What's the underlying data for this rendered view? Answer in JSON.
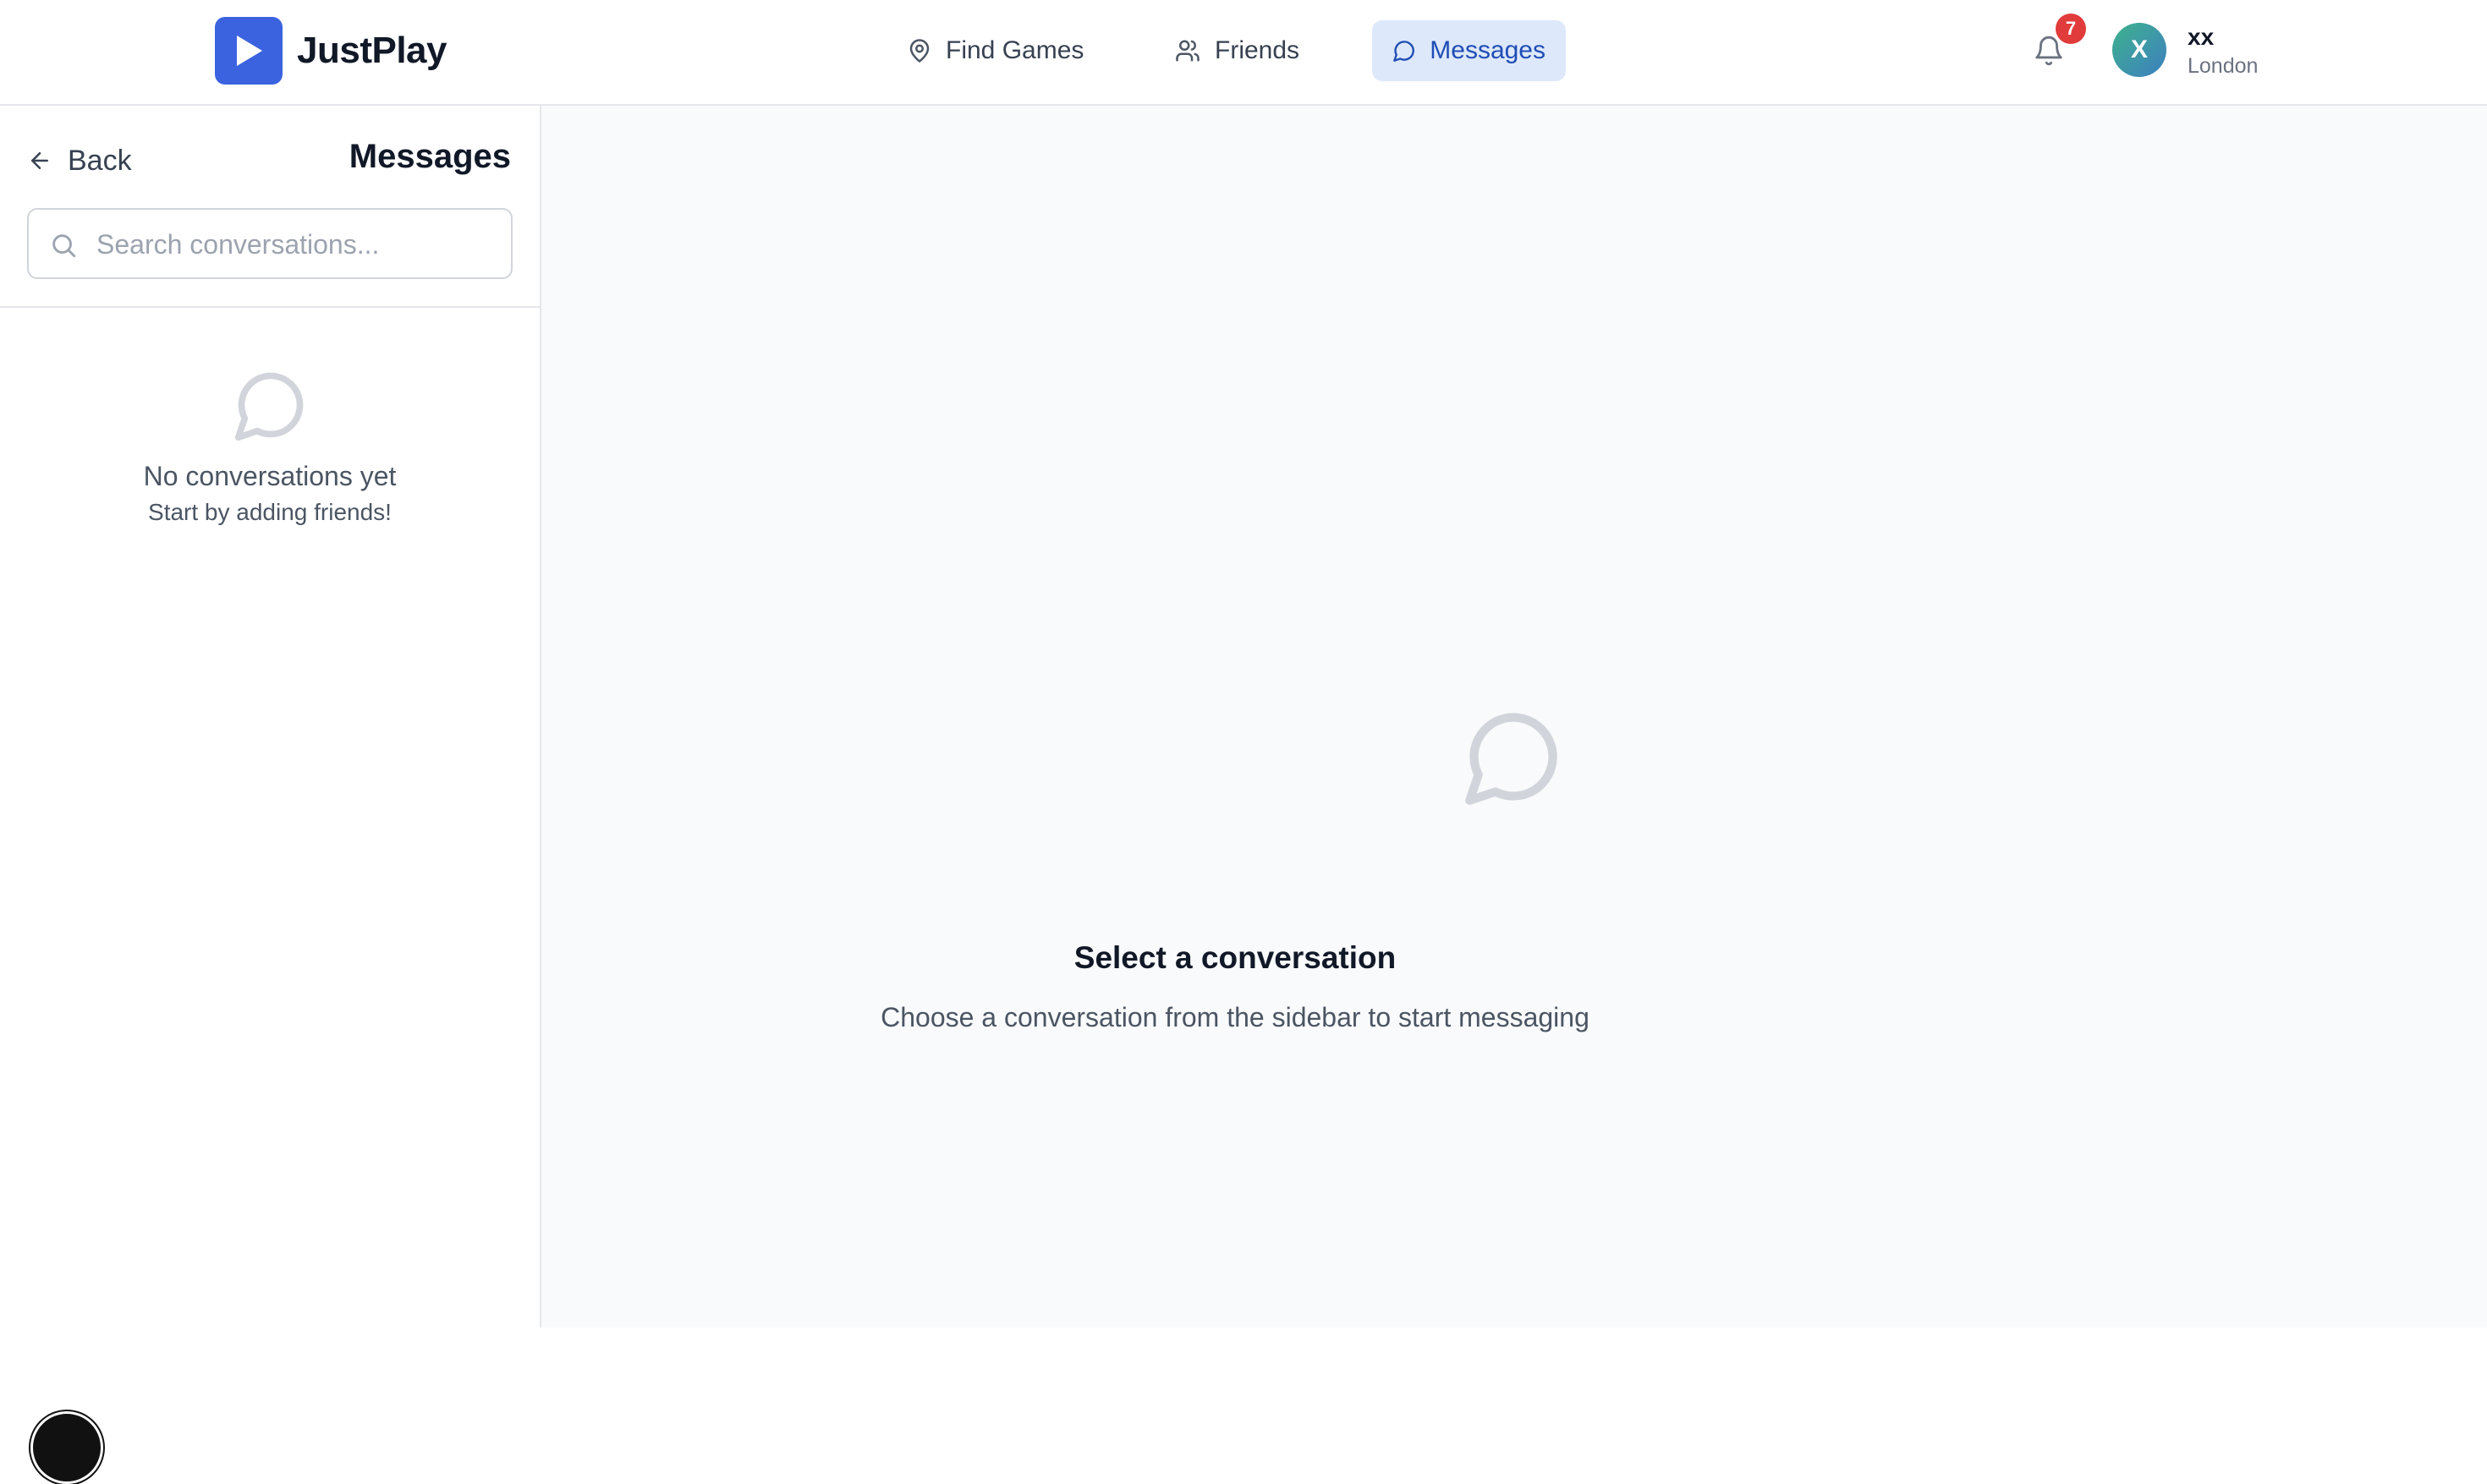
{
  "header": {
    "brand": "JustPlay",
    "nav": [
      {
        "label": "Find Games",
        "icon": "map-pin-icon"
      },
      {
        "label": "Friends",
        "icon": "users-icon"
      },
      {
        "label": "Messages",
        "icon": "message-circle-icon",
        "active": true
      }
    ],
    "notifications": {
      "icon": "bell-icon",
      "count": "7"
    },
    "user": {
      "initial": "X",
      "name": "xx",
      "location": "London"
    }
  },
  "sidebar": {
    "back_label": "Back",
    "title": "Messages",
    "search": {
      "placeholder": "Search conversations...",
      "value": ""
    },
    "empty_state": {
      "icon": "message-circle-icon",
      "title": "No conversations yet",
      "subtitle": "Start by adding friends!"
    }
  },
  "main": {
    "icon": "message-circle-icon",
    "title": "Select a conversation",
    "subtitle": "Choose a conversation from the sidebar to start messaging"
  },
  "colors": {
    "brand": "#3b63e0",
    "active_nav_bg": "#dde8fb",
    "active_nav_text": "#1f4db5",
    "badge": "#e23b3b"
  }
}
